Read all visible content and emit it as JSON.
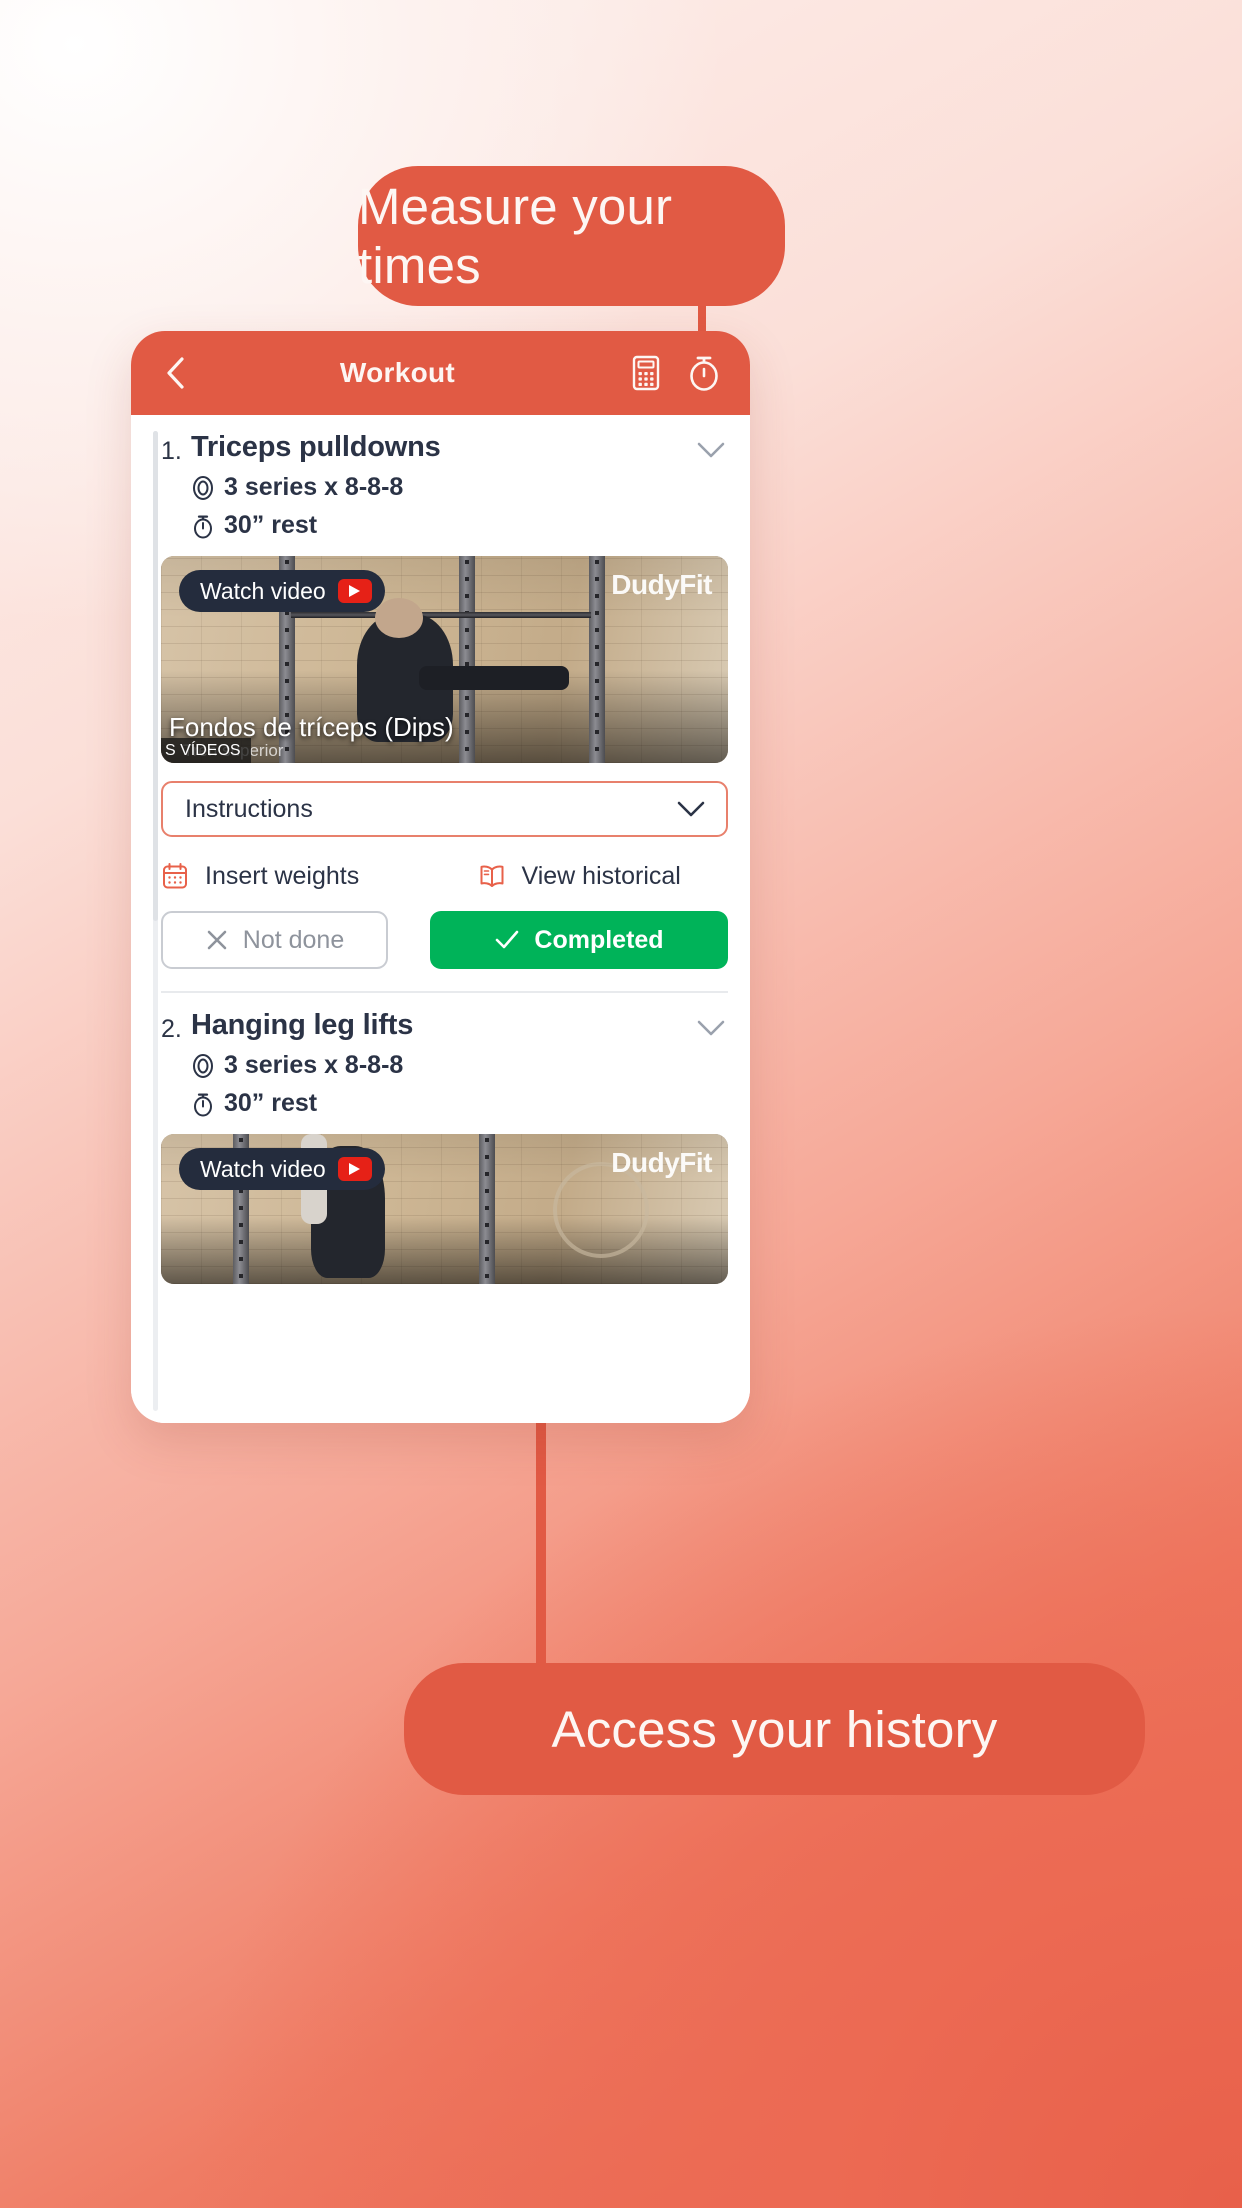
{
  "callouts": {
    "top": "Measure your times",
    "bottom": "Access your history"
  },
  "colors": {
    "brand": "#e15a44",
    "success": "#00b359",
    "text": "#2b3346",
    "muted": "#8e939c"
  },
  "app": {
    "header": {
      "title": "Workout",
      "back_icon": "chevron-left-icon",
      "calculator_icon": "calculator-icon",
      "timer_icon": "stopwatch-icon"
    },
    "exercises": [
      {
        "number": "1.",
        "title": "Triceps pulldowns",
        "series": "3 series x 8-8-8",
        "rest": "30” rest",
        "video": {
          "badge": "Watch video",
          "watermark": "DudyFit",
          "caption": "Fondos de tríceps (Dips)",
          "subcaption": "Tren superior",
          "chip": "S VÍDEOS"
        },
        "instructions_label": "Instructions",
        "actions": {
          "insert_weights": "Insert weights",
          "view_historical": "View historical"
        },
        "status": {
          "not_done": "Not done",
          "completed": "Completed"
        }
      },
      {
        "number": "2.",
        "title": "Hanging leg lifts",
        "series": "3 series x 8-8-8",
        "rest": "30” rest",
        "video": {
          "badge": "Watch video",
          "watermark": "DudyFit"
        }
      }
    ]
  }
}
